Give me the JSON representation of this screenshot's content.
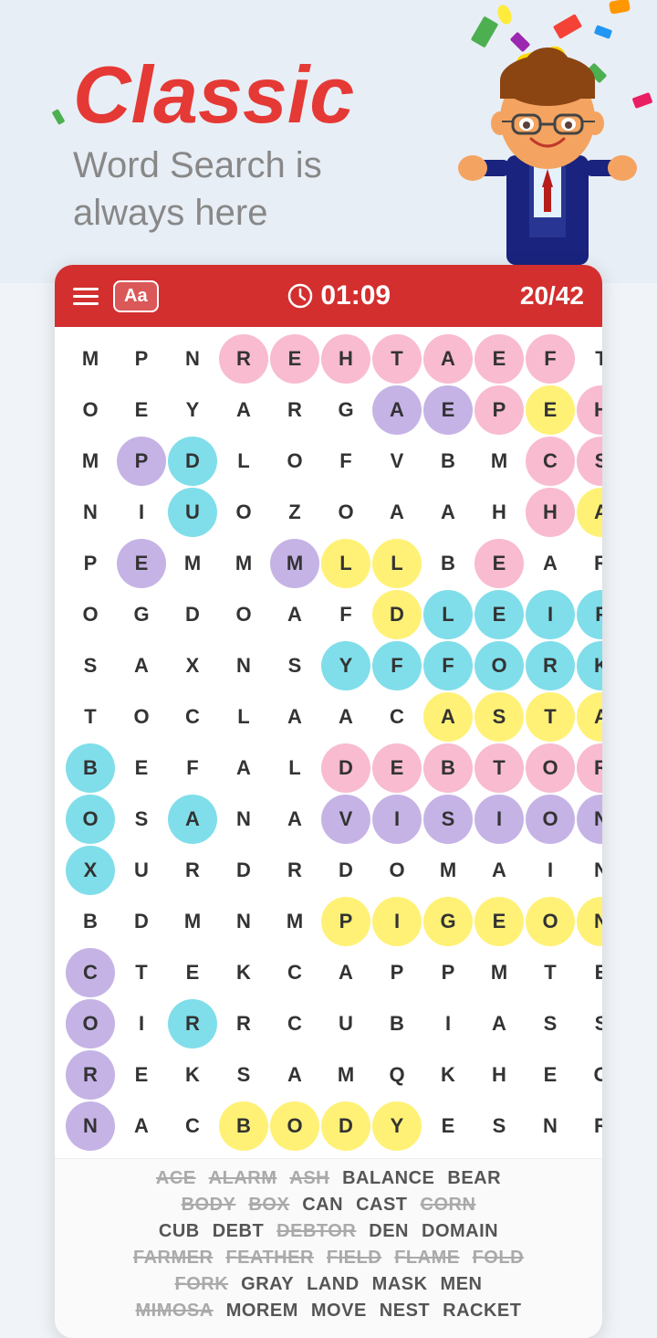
{
  "header": {
    "title": "Classic",
    "subtitle_line1": "Word Search is",
    "subtitle_line2": "always here"
  },
  "toolbar": {
    "menu_label": "menu",
    "font_label": "Aa",
    "timer": "01:09",
    "score": "20/42"
  },
  "grid": {
    "cells": [
      [
        "M",
        "P",
        "N",
        "R",
        "E",
        "H",
        "T",
        "A",
        "E",
        "F",
        "T"
      ],
      [
        "O",
        "E",
        "Y",
        "A",
        "R",
        "G",
        "A",
        "E",
        "P",
        "E",
        "H"
      ],
      [
        "M",
        "P",
        "D",
        "L",
        "O",
        "F",
        "V",
        "B",
        "M",
        "C",
        "S"
      ],
      [
        "N",
        "I",
        "U",
        "O",
        "Z",
        "O",
        "A",
        "A",
        "H",
        "H",
        "A"
      ],
      [
        "P",
        "E",
        "M",
        "M",
        "M",
        "L",
        "L",
        "B",
        "E",
        "A",
        "R"
      ],
      [
        "O",
        "G",
        "D",
        "O",
        "A",
        "F",
        "D",
        "L",
        "E",
        "I",
        "F"
      ],
      [
        "S",
        "A",
        "X",
        "N",
        "S",
        "Y",
        "F",
        "F",
        "O",
        "R",
        "K"
      ],
      [
        "T",
        "O",
        "C",
        "L",
        "A",
        "A",
        "C",
        "A",
        "S",
        "T",
        "A"
      ],
      [
        "B",
        "E",
        "F",
        "A",
        "L",
        "D",
        "E",
        "B",
        "T",
        "O",
        "R"
      ],
      [
        "O",
        "S",
        "A",
        "N",
        "A",
        "V",
        "I",
        "S",
        "I",
        "O",
        "N"
      ],
      [
        "X",
        "U",
        "R",
        "D",
        "R",
        "D",
        "O",
        "M",
        "A",
        "I",
        "N"
      ],
      [
        "B",
        "D",
        "M",
        "N",
        "M",
        "P",
        "I",
        "G",
        "E",
        "O",
        "N"
      ],
      [
        "C",
        "T",
        "E",
        "K",
        "C",
        "A",
        "P",
        "P",
        "M",
        "T",
        "E"
      ],
      [
        "O",
        "I",
        "R",
        "R",
        "C",
        "U",
        "B",
        "I",
        "A",
        "S",
        "S"
      ],
      [
        "R",
        "E",
        "K",
        "S",
        "A",
        "M",
        "Q",
        "K",
        "H",
        "E",
        "O"
      ],
      [
        "N",
        "A",
        "C",
        "B",
        "O",
        "D",
        "Y",
        "E",
        "S",
        "N",
        "R"
      ]
    ],
    "highlights": {
      "rehtaef": {
        "cells": [
          [
            0,
            3
          ],
          [
            0,
            4
          ],
          [
            0,
            5
          ],
          [
            0,
            6
          ],
          [
            0,
            7
          ],
          [
            0,
            8
          ],
          [
            0,
            9
          ]
        ],
        "color": "pink"
      },
      "vision": {
        "cells": [
          [
            9,
            5
          ],
          [
            9,
            6
          ],
          [
            9,
            7
          ],
          [
            9,
            8
          ],
          [
            9,
            9
          ],
          [
            9,
            10
          ]
        ],
        "color": "purple"
      },
      "debtor": {
        "cells": [
          [
            8,
            5
          ],
          [
            8,
            6
          ],
          [
            8,
            7
          ],
          [
            8,
            8
          ],
          [
            8,
            9
          ],
          [
            8,
            10
          ]
        ],
        "color": "pink"
      },
      "pigeon": {
        "cells": [
          [
            11,
            5
          ],
          [
            11,
            6
          ],
          [
            11,
            7
          ],
          [
            11,
            8
          ],
          [
            11,
            9
          ],
          [
            11,
            10
          ]
        ],
        "color": "yellow"
      },
      "fork": {
        "cells": [
          [
            6,
            7
          ],
          [
            6,
            8
          ],
          [
            6,
            9
          ],
          [
            6,
            10
          ]
        ],
        "color": "cyan"
      },
      "body": {
        "cells": [
          [
            15,
            3
          ],
          [
            15,
            4
          ],
          [
            15,
            5
          ],
          [
            15,
            6
          ]
        ],
        "color": "yellow"
      },
      "box": {
        "cells": [
          [
            8,
            0
          ],
          [
            9,
            0
          ],
          [
            10,
            0
          ]
        ],
        "color": "cyan"
      },
      "corn": {
        "cells": [
          [
            12,
            0
          ],
          [
            13,
            0
          ],
          [
            14,
            0
          ],
          [
            15,
            0
          ]
        ],
        "color": "purple"
      }
    }
  },
  "words": [
    {
      "text": "ACE",
      "found": true
    },
    {
      "text": "ALARM",
      "found": true
    },
    {
      "text": "ASH",
      "found": true
    },
    {
      "text": "BALANCE",
      "found": false
    },
    {
      "text": "BEAR",
      "found": false
    },
    {
      "text": "BODY",
      "found": true
    },
    {
      "text": "BOX",
      "found": true
    },
    {
      "text": "CAN",
      "found": false
    },
    {
      "text": "CAST",
      "found": false
    },
    {
      "text": "CORN",
      "found": true
    },
    {
      "text": "CUB",
      "found": false
    },
    {
      "text": "DEBT",
      "found": false
    },
    {
      "text": "DEBTOR",
      "found": true
    },
    {
      "text": "DEN",
      "found": false
    },
    {
      "text": "DOMAIN",
      "found": false
    },
    {
      "text": "FARMER",
      "found": true
    },
    {
      "text": "FEATHER",
      "found": true
    },
    {
      "text": "FIELD",
      "found": true
    },
    {
      "text": "FLAME",
      "found": true
    },
    {
      "text": "FOLD",
      "found": true
    },
    {
      "text": "FORK",
      "found": true
    },
    {
      "text": "GRAY",
      "found": false
    },
    {
      "text": "LAND",
      "found": false
    },
    {
      "text": "MASK",
      "found": false
    },
    {
      "text": "MEN",
      "found": false
    },
    {
      "text": "MIMOSA",
      "found": true
    },
    {
      "text": "MOREM",
      "found": false
    },
    {
      "text": "MOVE",
      "found": false
    },
    {
      "text": "NEST",
      "found": false
    },
    {
      "text": "RACKET",
      "found": false
    }
  ]
}
